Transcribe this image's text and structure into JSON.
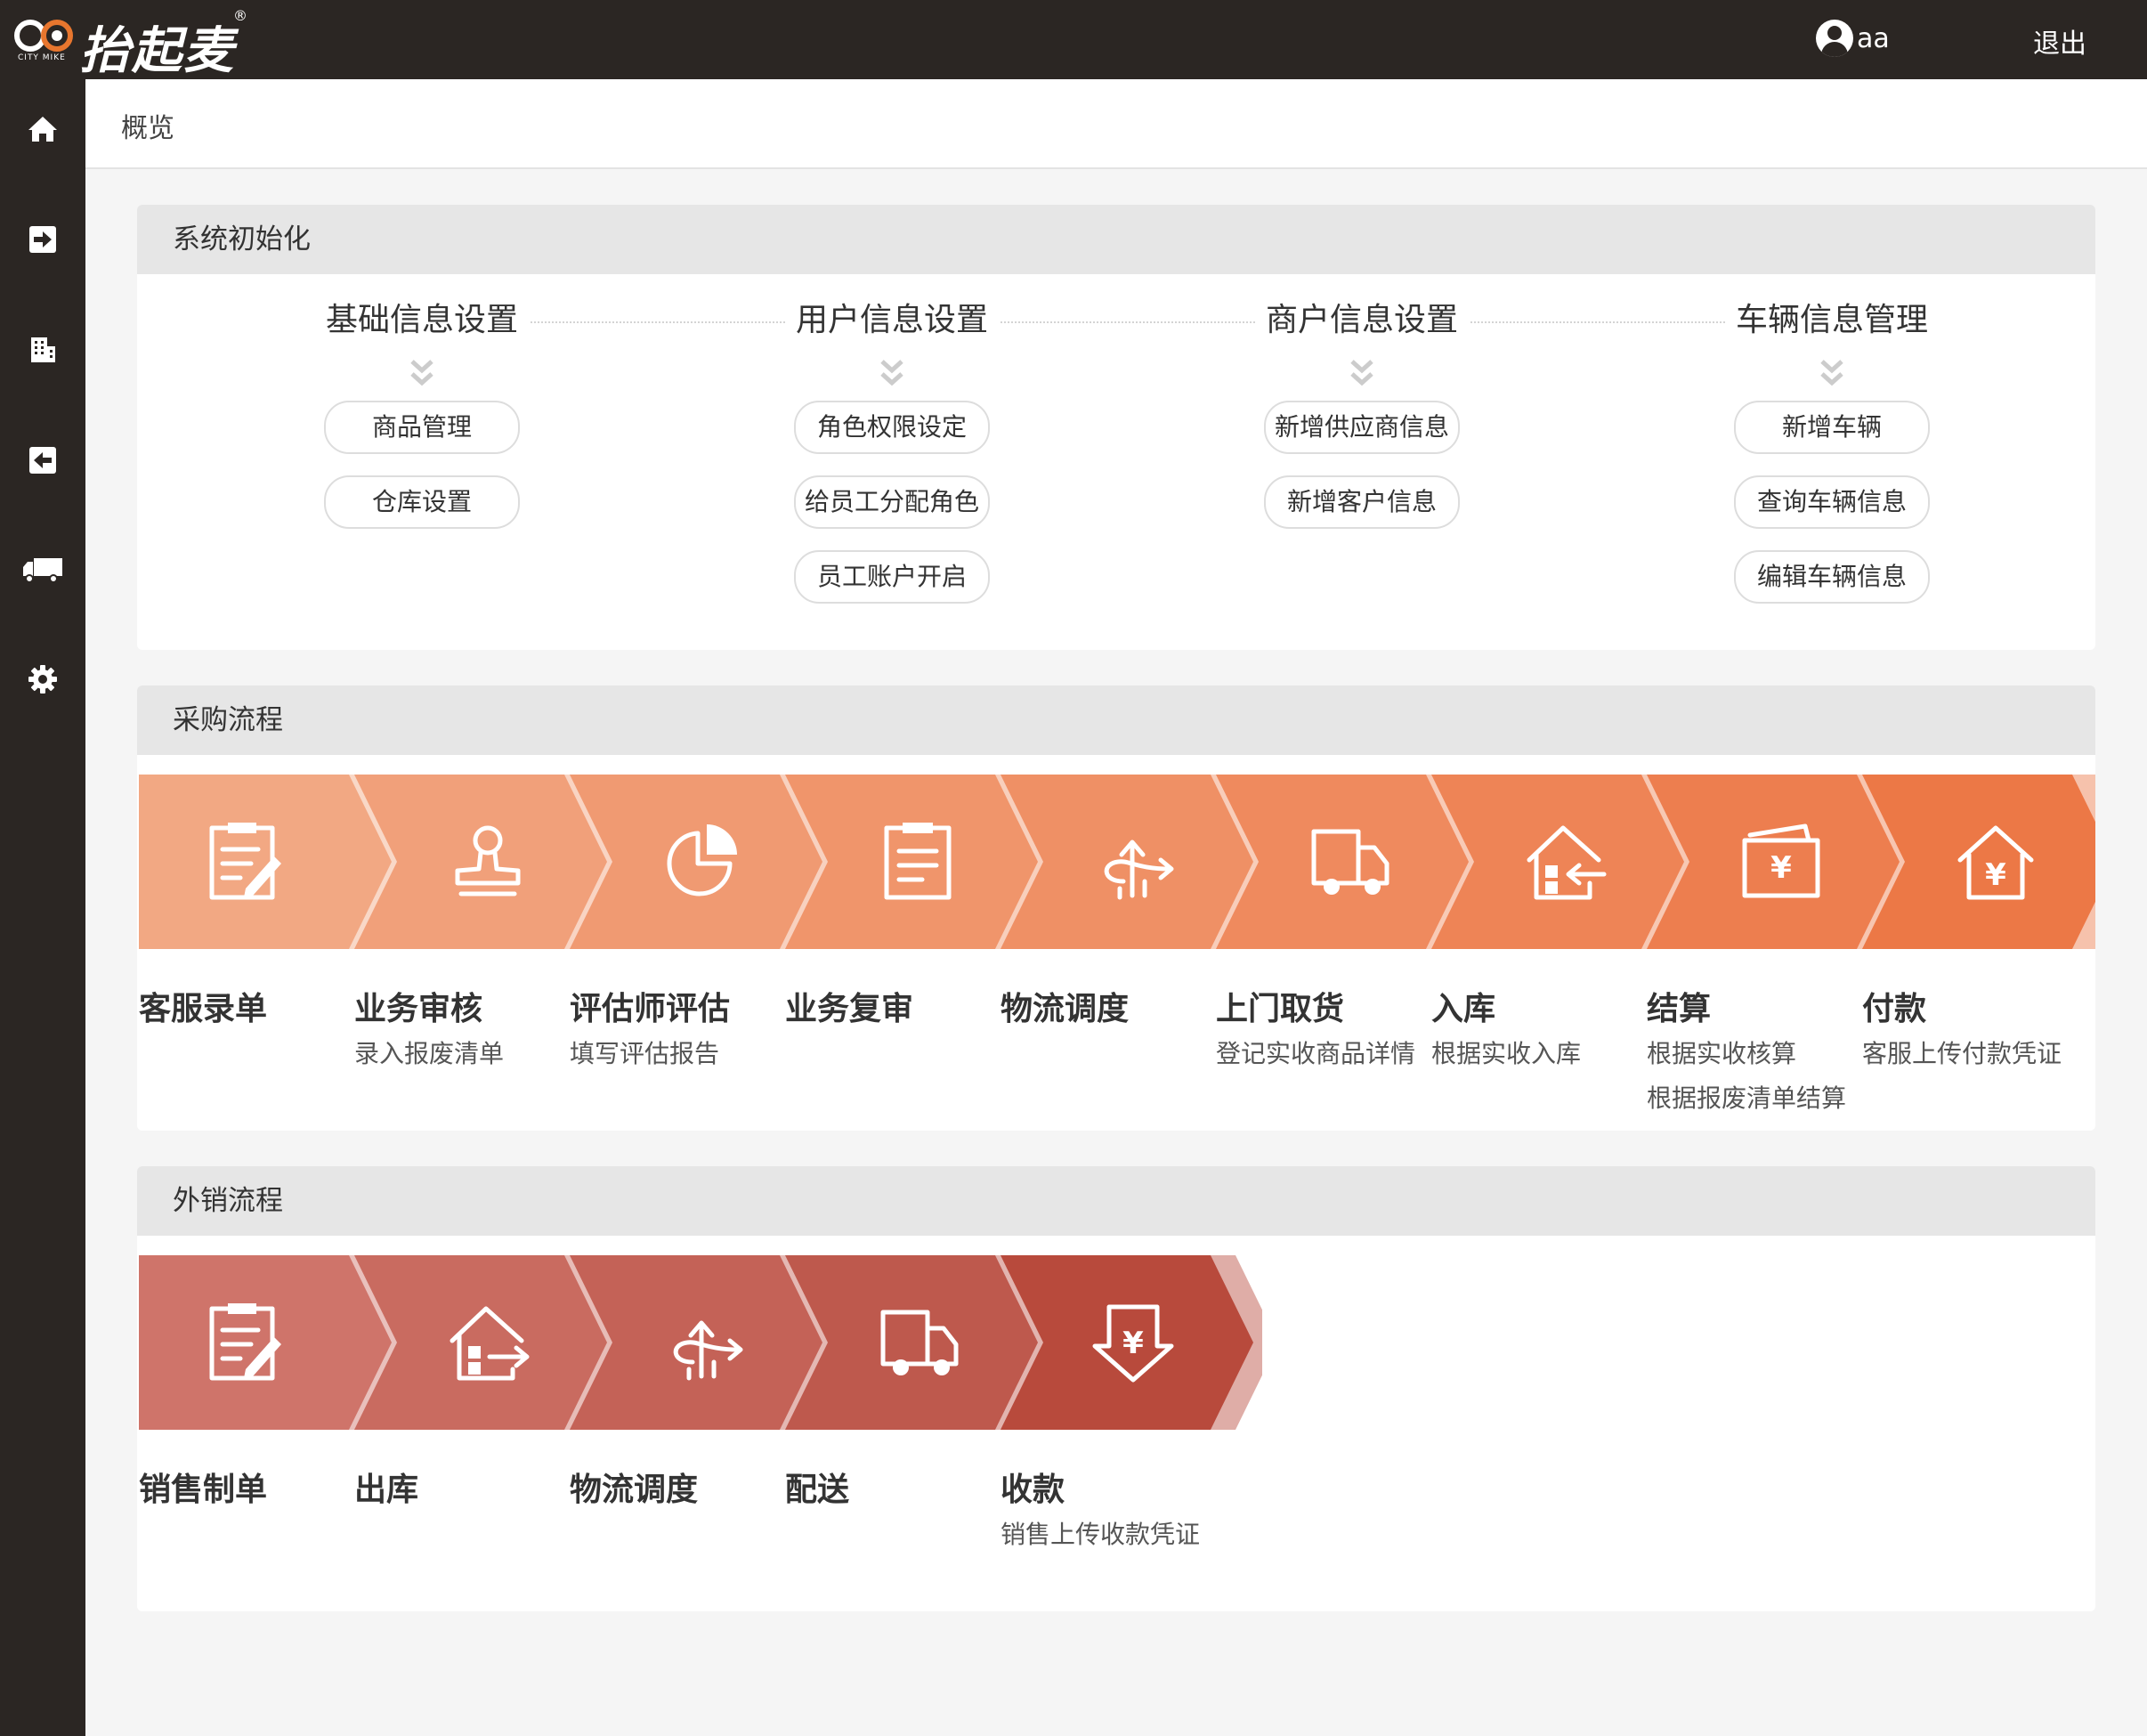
{
  "topbar": {
    "logo_text": "抬起麦",
    "logo_sub": "CITY MIKE",
    "logo_reg": "®",
    "user_name": "aa",
    "logout_label": "退出"
  },
  "sidebar": {
    "items": [
      {
        "icon": "home-icon"
      },
      {
        "icon": "sign-in-icon"
      },
      {
        "icon": "building-icon"
      },
      {
        "icon": "sign-out-icon"
      },
      {
        "icon": "truck-icon"
      },
      {
        "icon": "gear-icon"
      }
    ]
  },
  "breadcrumb": "概览",
  "init": {
    "title": "系统初始化",
    "columns": [
      {
        "title": "基础信息设置",
        "items": [
          "商品管理",
          "仓库设置"
        ]
      },
      {
        "title": "用户信息设置",
        "items": [
          "角色权限设定",
          "给员工分配角色",
          "员工账户开启"
        ]
      },
      {
        "title": "商户信息设置",
        "items": [
          "新增供应商信息",
          "新增客户信息"
        ]
      },
      {
        "title": "车辆信息管理",
        "items": [
          "新增车辆",
          "查询车辆信息",
          "编辑车辆信息"
        ]
      }
    ]
  },
  "purchase": {
    "title": "采购流程",
    "steps": [
      {
        "label": "客服录单",
        "subs": [],
        "icon": "clipboard-edit-icon",
        "color": "#f2a883"
      },
      {
        "label": "业务审核",
        "subs": [
          "录入报废清单"
        ],
        "icon": "stamp-icon",
        "color": "#f1a07a"
      },
      {
        "label": "评估师评估",
        "subs": [
          "填写评估报告"
        ],
        "icon": "pie-chart-icon",
        "color": "#f09a72"
      },
      {
        "label": "业务复审",
        "subs": [],
        "icon": "clipboard-icon",
        "color": "#f0956b"
      },
      {
        "label": "物流调度",
        "subs": [],
        "icon": "dispatch-arrows-icon",
        "color": "#ef9065"
      },
      {
        "label": "上门取货",
        "subs": [
          "登记实收商品详情"
        ],
        "icon": "truck-icon",
        "color": "#ef8a5e"
      },
      {
        "label": "入库",
        "subs": [
          "根据实收入库"
        ],
        "icon": "warehouse-in-icon",
        "color": "#ee8456"
      },
      {
        "label": "结算",
        "subs": [
          "根据实收核算",
          "根据报废清单结算"
        ],
        "icon": "settlement-icon",
        "color": "#ed7e4f"
      },
      {
        "label": "付款",
        "subs": [
          "客服上传付款凭证"
        ],
        "icon": "payment-house-icon",
        "color": "#ec7846"
      }
    ]
  },
  "sales": {
    "title": "外销流程",
    "steps": [
      {
        "label": "销售制单",
        "subs": [],
        "icon": "clipboard-edit-icon",
        "color": "#cf746a"
      },
      {
        "label": "出库",
        "subs": [],
        "icon": "warehouse-out-icon",
        "color": "#c96b60"
      },
      {
        "label": "物流调度",
        "subs": [],
        "icon": "dispatch-arrows-icon",
        "color": "#c46257"
      },
      {
        "label": "配送",
        "subs": [],
        "icon": "truck-icon",
        "color": "#be594d"
      },
      {
        "label": "收款",
        "subs": [
          "销售上传收款凭证"
        ],
        "icon": "receive-money-icon",
        "color": "#b84a3c"
      }
    ]
  }
}
